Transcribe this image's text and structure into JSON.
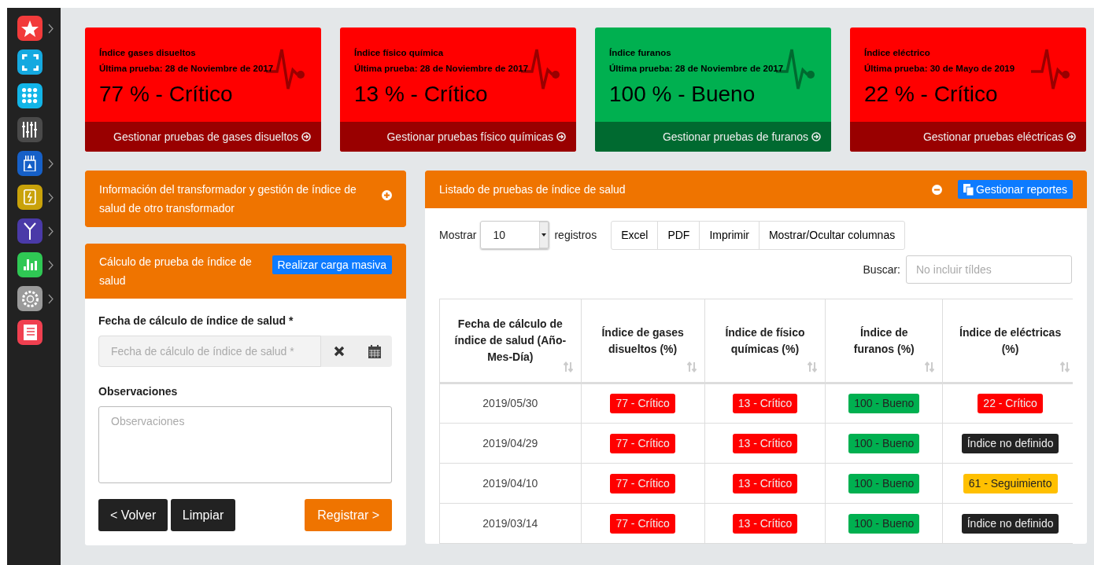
{
  "sidebar": {
    "items": [
      {
        "color": "#f23b3b",
        "has_submenu": true
      },
      {
        "color": "#15a9e0",
        "has_submenu": false
      },
      {
        "color": "#12b5e8",
        "has_submenu": false
      },
      {
        "color": "#4a4a4a",
        "has_submenu": false
      },
      {
        "color": "#1660c8",
        "has_submenu": true
      },
      {
        "color": "#c9a20a",
        "has_submenu": true
      },
      {
        "color": "#4a3aa8",
        "has_submenu": true
      },
      {
        "color": "#2fc854",
        "has_submenu": true
      },
      {
        "color": "#9a9a9a",
        "has_submenu": true
      },
      {
        "color": "#f04050",
        "has_submenu": false
      }
    ]
  },
  "index_cards": [
    {
      "title": "Índice gases disueltos",
      "last_test": "Última prueba: 28 de Noviembre de 2017",
      "value": "77 % - Crítico",
      "link": "Gestionar pruebas de gases disueltos",
      "color": "#ff0000"
    },
    {
      "title": "Índice físico química",
      "last_test": "Última prueba: 28 de Noviembre de 2017",
      "value": "13 % - Crítico",
      "link": "Gestionar pruebas físico químicas",
      "color": "#ff0000"
    },
    {
      "title": "Índice furanos",
      "last_test": "Última prueba: 28 de Noviembre de 2017",
      "value": "100 % - Bueno",
      "link": "Gestionar pruebas de furanos",
      "color": "#00b050"
    },
    {
      "title": "Índice eléctrico",
      "last_test": "Última prueba: 30 de Mayo de 2019",
      "value": "22 % - Crítico",
      "link": "Gestionar pruebas eléctricas",
      "color": "#ff0000"
    }
  ],
  "transformer_panel": {
    "title": "Información del transformador y gestión de índice de salud de otro transformador",
    "expanded": false
  },
  "calc_panel": {
    "title": "Cálculo de prueba de índice de salud",
    "bulk_button": "Realizar carga masiva",
    "date_label": "Fecha de cálculo de índice de salud *",
    "date_placeholder": "Fecha de cálculo de índice de salud *",
    "obs_label": "Observaciones",
    "obs_placeholder": "Observaciones",
    "buttons": [
      {
        "label": "< Volver",
        "kind": "dark"
      },
      {
        "label": "Limpiar",
        "kind": "dark"
      },
      {
        "label": "Registrar >",
        "kind": "primary"
      }
    ]
  },
  "tests_panel": {
    "title": "Listado de pruebas de índice de salud",
    "expanded": true,
    "reports_button": "Gestionar reportes",
    "show_label": "Mostrar",
    "page_size": "10",
    "records_label": "registros",
    "export_buttons": [
      "Excel",
      "PDF",
      "Imprimir",
      "Mostrar/Ocultar columnas"
    ],
    "search_label": "Buscar:",
    "search_placeholder": "No incluir tíldes",
    "table": {
      "columns": [
        "Fecha de cálculo de índice de salud (Año-Mes-Día)",
        "Índice de gases disueltos (%)",
        "Índice de físico químicas (%)",
        "Índice de furanos (%)",
        "Índice de eléctricas (%)"
      ],
      "rows": [
        {
          "cells": [
            {
              "kind": "date",
              "text": "2019/05/30"
            },
            {
              "text": "77 - Crítico",
              "color": "#ff0000"
            },
            {
              "text": "13 - Crítico",
              "color": "#ff0000"
            },
            {
              "text": "100 - Bueno",
              "color": "#00b050"
            },
            {
              "text": "22 - Crítico",
              "color": "#ff0000"
            }
          ]
        },
        {
          "cells": [
            {
              "kind": "date",
              "text": "2019/04/29"
            },
            {
              "text": "77 - Crítico",
              "color": "#ff0000"
            },
            {
              "text": "13 - Crítico",
              "color": "#ff0000"
            },
            {
              "text": "100 - Bueno",
              "color": "#00b050"
            },
            {
              "text": "Índice no definido",
              "color": "#222222"
            }
          ]
        },
        {
          "cells": [
            {
              "kind": "date",
              "text": "2019/04/10"
            },
            {
              "text": "77 - Crítico",
              "color": "#ff0000"
            },
            {
              "text": "13 - Crítico",
              "color": "#ff0000"
            },
            {
              "text": "100 - Bueno",
              "color": "#00b050"
            },
            {
              "text": "61 - Seguimiento",
              "color": "#ffc000"
            }
          ]
        },
        {
          "cells": [
            {
              "kind": "date",
              "text": "2019/03/14"
            },
            {
              "text": "77 - Crítico",
              "color": "#ff0000"
            },
            {
              "text": "13 - Crítico",
              "color": "#ff0000"
            },
            {
              "text": "100 - Bueno",
              "color": "#00b050"
            },
            {
              "text": "Índice no definido",
              "color": "#222222"
            }
          ]
        }
      ]
    }
  }
}
